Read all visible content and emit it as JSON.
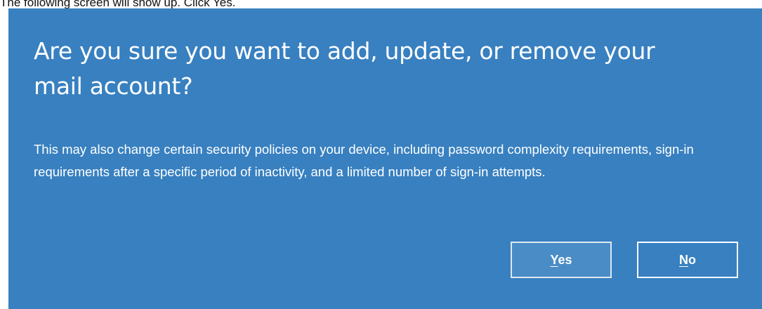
{
  "caption": "The following screen will show up. Click Yes.",
  "dialog": {
    "title": "Are you sure you want to add, update, or remove your mail account?",
    "message": "This may also change certain security policies on your device, including password complexity requirements, sign-in requirements after a specific period of inactivity, and a limited number of sign-in attempts.",
    "buttons": {
      "yes": {
        "mnemonic": "Y",
        "rest": "es"
      },
      "no": {
        "mnemonic": "N",
        "rest": "o"
      }
    },
    "colors": {
      "background": "#3880c0",
      "text": "#ffffff",
      "default_button_fill": "#4a8cc6"
    }
  }
}
